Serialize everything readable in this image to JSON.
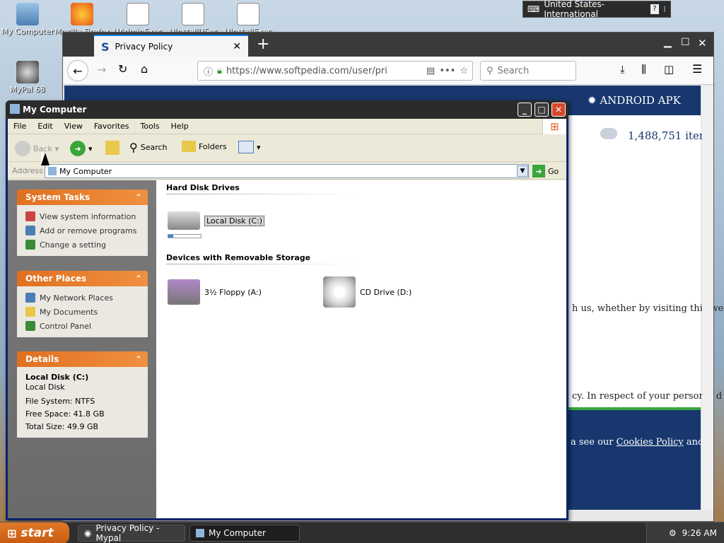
{
  "desktop": {
    "icons": [
      {
        "label": "My Computer"
      },
      {
        "label": "Mozilla Firefox"
      },
      {
        "label": "UAdminExec"
      },
      {
        "label": "UInstallUSer"
      },
      {
        "label": "UInstallExec"
      },
      {
        "label": "MyPal 68"
      }
    ],
    "language_bar": "United States-International"
  },
  "firefox": {
    "tab_title": "Privacy Policy",
    "url": "https://www.softpedia.com/user/pri",
    "search_placeholder": "Search",
    "page": {
      "nav_android": "ANDROID APK",
      "items_count": "1,488,751 iten",
      "text1": "h us, whether by visiting this we",
      "text2": "cy. In respect of your personal d",
      "footer_text_pre": "a see our",
      "footer_link": "Cookies Policy",
      "footer_text_post": "and"
    }
  },
  "explorer": {
    "title": "My Computer",
    "menu": [
      "File",
      "Edit",
      "View",
      "Favorites",
      "Tools",
      "Help"
    ],
    "toolbar": {
      "back": "Back",
      "search": "Search",
      "folders": "Folders"
    },
    "address_label": "Address",
    "address_value": "My Computer",
    "go_label": "Go",
    "system_tasks": {
      "title": "System Tasks",
      "items": [
        "View system information",
        "Add or remove programs",
        "Change a setting"
      ]
    },
    "other_places": {
      "title": "Other Places",
      "items": [
        "My Network Places",
        "My Documents",
        "Control Panel"
      ]
    },
    "details": {
      "title": "Details",
      "name": "Local Disk (C:)",
      "type": "Local Disk",
      "file_system": "File System: NTFS",
      "free_space": "Free Space: 41.8 GB",
      "total_size": "Total Size: 49.9 GB"
    },
    "groups": {
      "hard_disks": "Hard Disk Drives",
      "removable": "Devices with Removable Storage"
    },
    "drives": {
      "local_disk": "Local Disk (C:)",
      "local_disk_usage": 0.16,
      "floppy": "3½ Floppy (A:)",
      "cd": "CD Drive (D:)"
    }
  },
  "taskbar": {
    "start": "start",
    "tasks": [
      "Privacy Policy - Mypal",
      "My Computer"
    ],
    "clock": "9:26 AM"
  }
}
